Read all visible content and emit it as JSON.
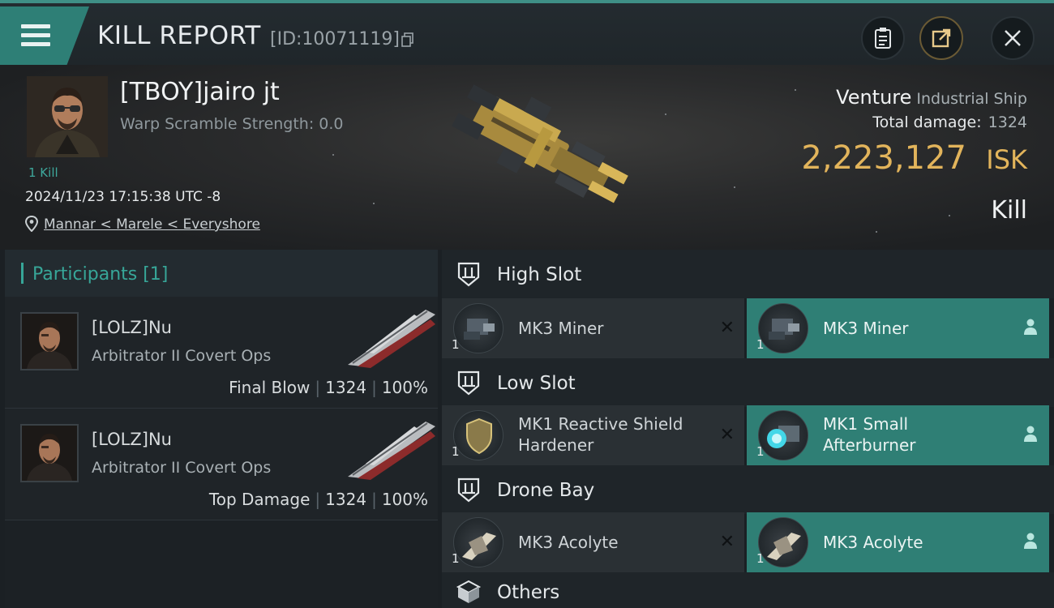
{
  "header": {
    "title": "KILL REPORT",
    "report_id": "[ID:10071119]",
    "icons": [
      "menu-icon",
      "copy-icon",
      "clipboard-icon",
      "share-icon",
      "close-icon"
    ]
  },
  "victim": {
    "name": "[TBOY]jairo jt",
    "warp_scramble": "Warp Scramble Strength: 0.0",
    "kills": "1 Kill",
    "datetime": "2024/11/23 17:15:38 UTC -8",
    "location": "Mannar < Marele < Everyshore",
    "ship_name": "Venture",
    "ship_class": "Industrial Ship",
    "total_damage_label": "Total damage:",
    "total_damage": "1324",
    "isk_value": "2,223,127",
    "isk_unit": "ISK",
    "result": "Kill"
  },
  "participants": {
    "title": "Participants [1]",
    "rows": [
      {
        "name": "[LOLZ]Nu",
        "ship": "Arbitrator II Covert Ops",
        "role": "Final Blow",
        "damage": "1324",
        "percent": "100%"
      },
      {
        "name": "[LOLZ]Nu",
        "ship": "Arbitrator II Covert Ops",
        "role": "Top Damage",
        "damage": "1324",
        "percent": "100%"
      }
    ]
  },
  "fitting": {
    "high_slot": {
      "title": "High Slot",
      "lost": {
        "qty": "1",
        "name_lines": [
          "MK3 Miner"
        ]
      },
      "dropped": {
        "qty": "1",
        "name_lines": [
          "MK3 Miner"
        ]
      }
    },
    "low_slot": {
      "title": "Low Slot",
      "lost": {
        "qty": "1",
        "name_lines": [
          "MK1 Reactive Shield",
          "Hardener"
        ]
      },
      "dropped": {
        "qty": "1",
        "name_lines": [
          "MK1 Small",
          "Afterburner"
        ]
      }
    },
    "drone_bay": {
      "title": "Drone Bay",
      "lost": {
        "qty": "1",
        "name_lines": [
          "MK3  Acolyte"
        ]
      },
      "dropped": {
        "qty": "1",
        "name_lines": [
          "MK3  Acolyte"
        ]
      }
    },
    "others": {
      "title": "Others"
    },
    "lost_marker": "✕"
  },
  "colors": {
    "accent": "#37a698",
    "isk": "#e2b45b",
    "dropped_bg": "#2f7f75"
  }
}
